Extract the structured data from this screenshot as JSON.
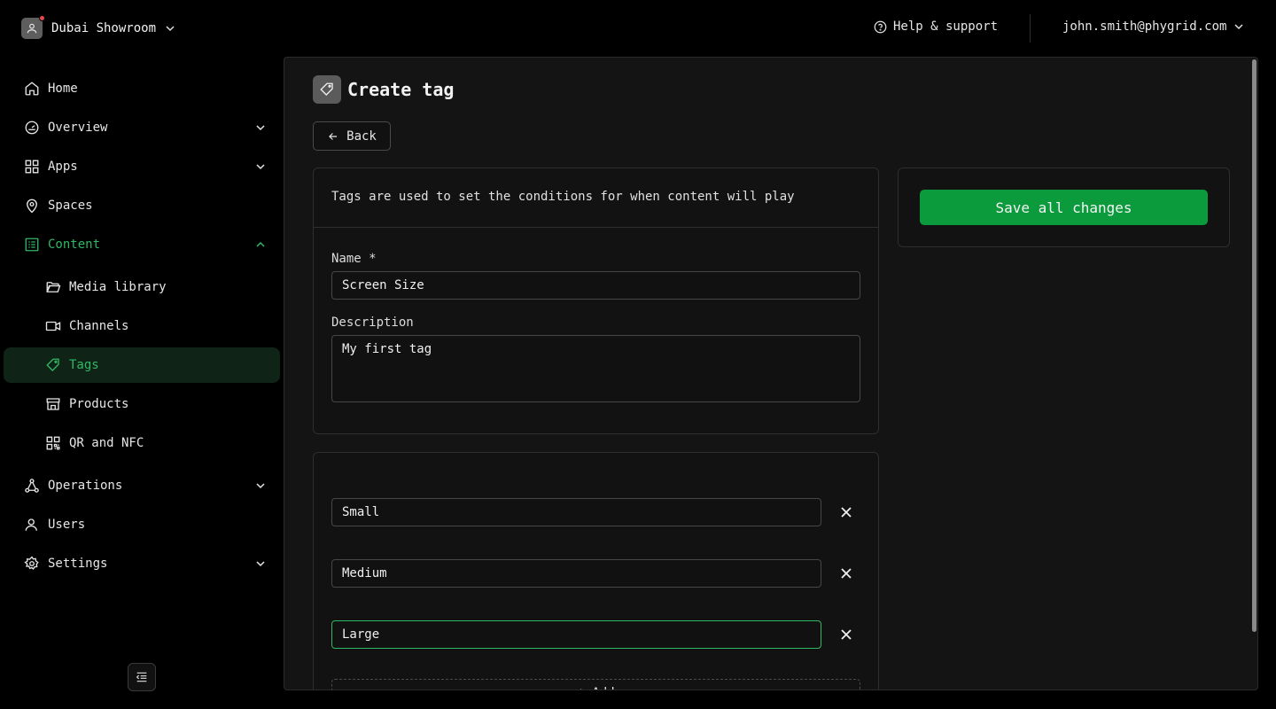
{
  "header": {
    "org_name": "Dubai Showroom",
    "help_label": "Help & support",
    "account_email": "john.smith@phygrid.com"
  },
  "sidebar": {
    "items": [
      {
        "label": "Home",
        "icon": "home-icon"
      },
      {
        "label": "Overview",
        "icon": "gauge-icon",
        "expandable": true
      },
      {
        "label": "Apps",
        "icon": "grid-icon",
        "expandable": true
      },
      {
        "label": "Spaces",
        "icon": "map-pin-icon"
      },
      {
        "label": "Content",
        "icon": "list-icon",
        "expanded": true,
        "state": "active-parent"
      },
      {
        "label": "Media library",
        "icon": "folder-icon",
        "sub": true
      },
      {
        "label": "Channels",
        "icon": "video-icon",
        "sub": true
      },
      {
        "label": "Tags",
        "icon": "tag-icon",
        "sub": true,
        "state": "active"
      },
      {
        "label": "Products",
        "icon": "store-icon",
        "sub": true
      },
      {
        "label": "QR and NFC",
        "icon": "qr-code-icon",
        "sub": true
      },
      {
        "label": "Operations",
        "icon": "network-icon",
        "expandable": true
      },
      {
        "label": "Users",
        "icon": "user-icon"
      },
      {
        "label": "Settings",
        "icon": "gear-icon",
        "expandable": true
      }
    ]
  },
  "page": {
    "title": "Create tag",
    "back_label": "Back",
    "hint": "Tags are used to set the conditions for when content will play",
    "name_label": "Name *",
    "name_value": "Screen Size",
    "description_label": "Description",
    "description_value": "My first tag",
    "values": [
      "Small",
      "Medium",
      "Large"
    ],
    "add_label": "+ Add",
    "save_label": "Save all changes"
  },
  "colors": {
    "accent": "#2fb865",
    "save_button": "#0b9a3c",
    "background": "#000000",
    "panel": "#141414"
  }
}
